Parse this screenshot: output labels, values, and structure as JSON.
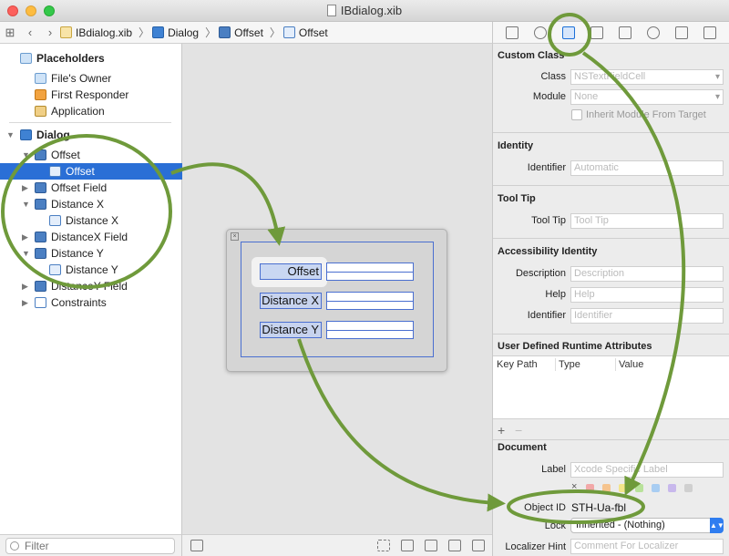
{
  "window": {
    "title": "IBdialog.xib"
  },
  "jumpbar": {
    "crumbs": [
      "IBdialog.xib",
      "Dialog",
      "Offset",
      "Offset"
    ]
  },
  "outline": {
    "placeholders_title": "Placeholders",
    "files_owner": "File's Owner",
    "first_responder": "First Responder",
    "application": "Application",
    "dialog": "Dialog",
    "items": [
      {
        "label": "Offset",
        "icon": "view-icon"
      },
      {
        "label": "Offset",
        "icon": "cell-icon",
        "selected": true
      },
      {
        "label": "Offset Field",
        "icon": "view-icon"
      },
      {
        "label": "Distance X",
        "icon": "view-icon"
      },
      {
        "label": "Distance X",
        "icon": "cell-icon"
      },
      {
        "label": "DistanceX Field",
        "icon": "view-icon"
      },
      {
        "label": "Distance Y",
        "icon": "view-icon"
      },
      {
        "label": "Distance Y",
        "icon": "cell-icon"
      },
      {
        "label": "DistanceY Field",
        "icon": "view-icon"
      },
      {
        "label": "Constraints",
        "icon": "constraints-icon"
      }
    ],
    "filter_placeholder": "Filter"
  },
  "canvas": {
    "labels": [
      "Offset",
      "Distance X",
      "Distance Y"
    ]
  },
  "inspector": {
    "custom_class": {
      "title": "Custom Class",
      "class_label": "Class",
      "class_placeholder": "NSTextFieldCell",
      "module_label": "Module",
      "module_placeholder": "None",
      "inherit_label": "Inherit Module From Target"
    },
    "identity": {
      "title": "Identity",
      "identifier_label": "Identifier",
      "identifier_placeholder": "Automatic"
    },
    "tooltip": {
      "title": "Tool Tip",
      "label": "Tool Tip",
      "placeholder": "Tool Tip"
    },
    "accessibility": {
      "title": "Accessibility Identity",
      "description_label": "Description",
      "description_placeholder": "Description",
      "help_label": "Help",
      "help_placeholder": "Help",
      "identifier_label": "Identifier",
      "identifier_placeholder": "Identifier"
    },
    "runtime": {
      "title": "User Defined Runtime Attributes",
      "col_keypath": "Key Path",
      "col_type": "Type",
      "col_value": "Value",
      "plus": "+",
      "minus": "−"
    },
    "document": {
      "title": "Document",
      "label_label": "Label",
      "label_placeholder": "Xcode Specific Label",
      "x_mark": "×",
      "objectid_label": "Object ID",
      "objectid_value": "STH-Ua-fbl",
      "lock_label": "Lock",
      "lock_value": "Inherited - (Nothing)",
      "hint_label": "Localizer Hint",
      "hint_placeholder": "Comment For Localizer"
    },
    "swatch_colors": [
      "#f2a8a8",
      "#f6c48e",
      "#f3e58a",
      "#b8e29a",
      "#a8cdf2",
      "#c8b8ec",
      "#d0d0d0"
    ]
  },
  "colors": {
    "accent": "#2a6fd6",
    "annotation": "#6f9a3b"
  }
}
